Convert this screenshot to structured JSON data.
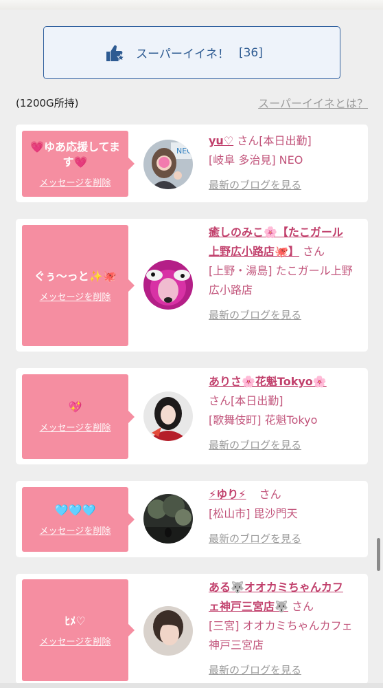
{
  "super_like": {
    "label": "スーパーイイネ！",
    "count": "[36]"
  },
  "owned_text": "(1200G所持)",
  "about_link": "スーパーイイネとは？",
  "cards": [
    {
      "message": "💗ゆあ応援してます💗",
      "delete": "メッセージを削除",
      "name": "yu♡",
      "san": "さん",
      "status": "[本日出勤]",
      "area": "[岐阜 多治見] NEO",
      "blog": "最新のブログを見る"
    },
    {
      "message": "ぐぅ〜っと✨🐙",
      "delete": "メッセージを削除",
      "name": "癒しのみこ🌸【たこガール上野広小路店🐙】",
      "san": "さん",
      "status": "",
      "area": "[上野・湯島] たこガール上野広小路店",
      "blog": "最新のブログを見る"
    },
    {
      "message": "💖",
      "delete": "メッセージを削除",
      "name": "ありさ🌸花魁Tokyo🌸",
      "san": "さん",
      "status": "[本日出勤]",
      "area": "[歌舞伎町] 花魁Tokyo",
      "blog": "最新のブログを見る"
    },
    {
      "message": "🩵🩵🩵",
      "delete": "メッセージを削除",
      "name": "⚡ゆり⚡",
      "san": "さん",
      "status": "",
      "area": "[松山市] 毘沙門天",
      "blog": "最新のブログを見る"
    },
    {
      "message": "ﾋﾒ♡",
      "delete": "メッセージを削除",
      "name": "ある🐺オオカミちゃんカフェ神戸三宮店🐺",
      "san": "さん",
      "status": "",
      "area": "[三宮] オオカミちゃんカフェ神戸三宮店",
      "blog": "最新のブログを見る"
    }
  ],
  "colors": {
    "accent_blue": "#2e5b92",
    "bubble_pink": "#f58ea1",
    "name_pink": "#c1406c",
    "background": "#eeeeee"
  },
  "icons": {
    "super_like": "thumbs-up-star-icon"
  }
}
